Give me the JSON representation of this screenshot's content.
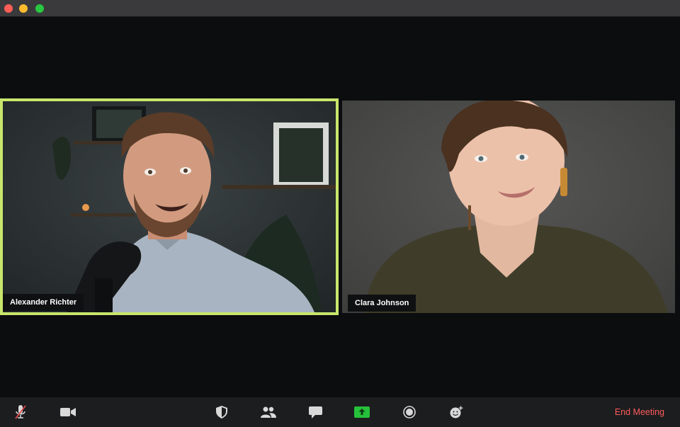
{
  "window": {
    "controls": [
      "close",
      "minimize",
      "maximize"
    ]
  },
  "participants": [
    {
      "name": "Alexander Richter",
      "active_speaker": true
    },
    {
      "name": "Clara Johnson",
      "active_speaker": false
    }
  ],
  "toolbar": {
    "buttons": [
      {
        "id": "mute",
        "icon": "microphone-muted-icon"
      },
      {
        "id": "video",
        "icon": "video-camera-icon"
      },
      {
        "id": "security",
        "icon": "shield-icon"
      },
      {
        "id": "participants",
        "icon": "participants-icon"
      },
      {
        "id": "chat",
        "icon": "chat-bubble-icon"
      },
      {
        "id": "share",
        "icon": "share-screen-icon"
      },
      {
        "id": "record",
        "icon": "record-icon"
      },
      {
        "id": "reactions",
        "icon": "emoji-reaction-icon"
      }
    ],
    "end_label": "End Meeting"
  },
  "colors": {
    "active_speaker_border": "#c8e66b",
    "share_green": "#26c13a",
    "end_red": "#ff5b5b",
    "mute_red": "#e5484d"
  }
}
